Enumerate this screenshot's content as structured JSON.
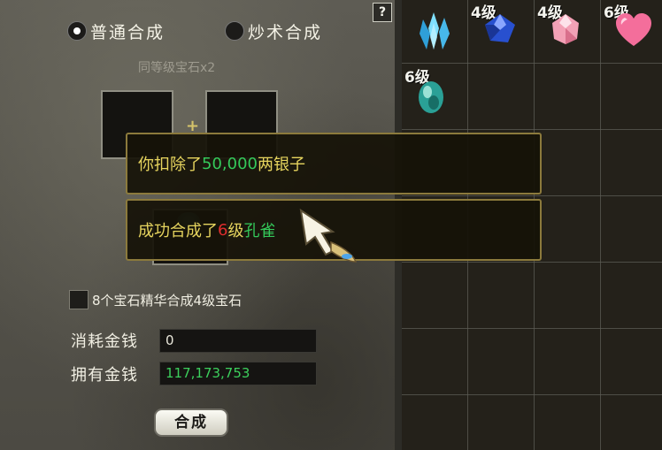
{
  "help": {
    "label": "?"
  },
  "modes": [
    {
      "label": "普通合成",
      "selected": true
    },
    {
      "label": "炒术合成",
      "selected": false
    }
  ],
  "hint": "同等级宝石x2",
  "plus": "+",
  "essence_option": {
    "label": "8个宝石精华合成4级宝石",
    "checked": false
  },
  "cost": {
    "label": "消耗金钱",
    "value": "0"
  },
  "owned": {
    "label": "拥有金钱",
    "value": "117,173,753"
  },
  "synth_button": "合成",
  "inventory": [
    {
      "level": "",
      "gem": "blue-crystal-cluster-icon",
      "color": "#3fb6e8"
    },
    {
      "level": "4级",
      "gem": "sapphire-icon",
      "color": "#2f58d9"
    },
    {
      "level": "4级",
      "gem": "pink-diamond-icon",
      "color": "#f3a3b8"
    },
    {
      "level": "6级",
      "gem": "pink-heart-gem-icon",
      "color": "#f56f9c"
    },
    {
      "level": "6级",
      "gem": "teal-peacock-gem-icon",
      "color": "#2fa39a"
    }
  ],
  "notices": {
    "deduct": {
      "prefix": "你扣除了",
      "amount": "50,000",
      "suffix": "两银子"
    },
    "success": {
      "prefix": "成功合成了",
      "level_num": "6",
      "level_suffix": "级",
      "item": "孔雀"
    }
  },
  "colors": {
    "notice_text": "#e6d45e",
    "highlight_green": "#34c95a",
    "highlight_red": "#e02e2e"
  }
}
